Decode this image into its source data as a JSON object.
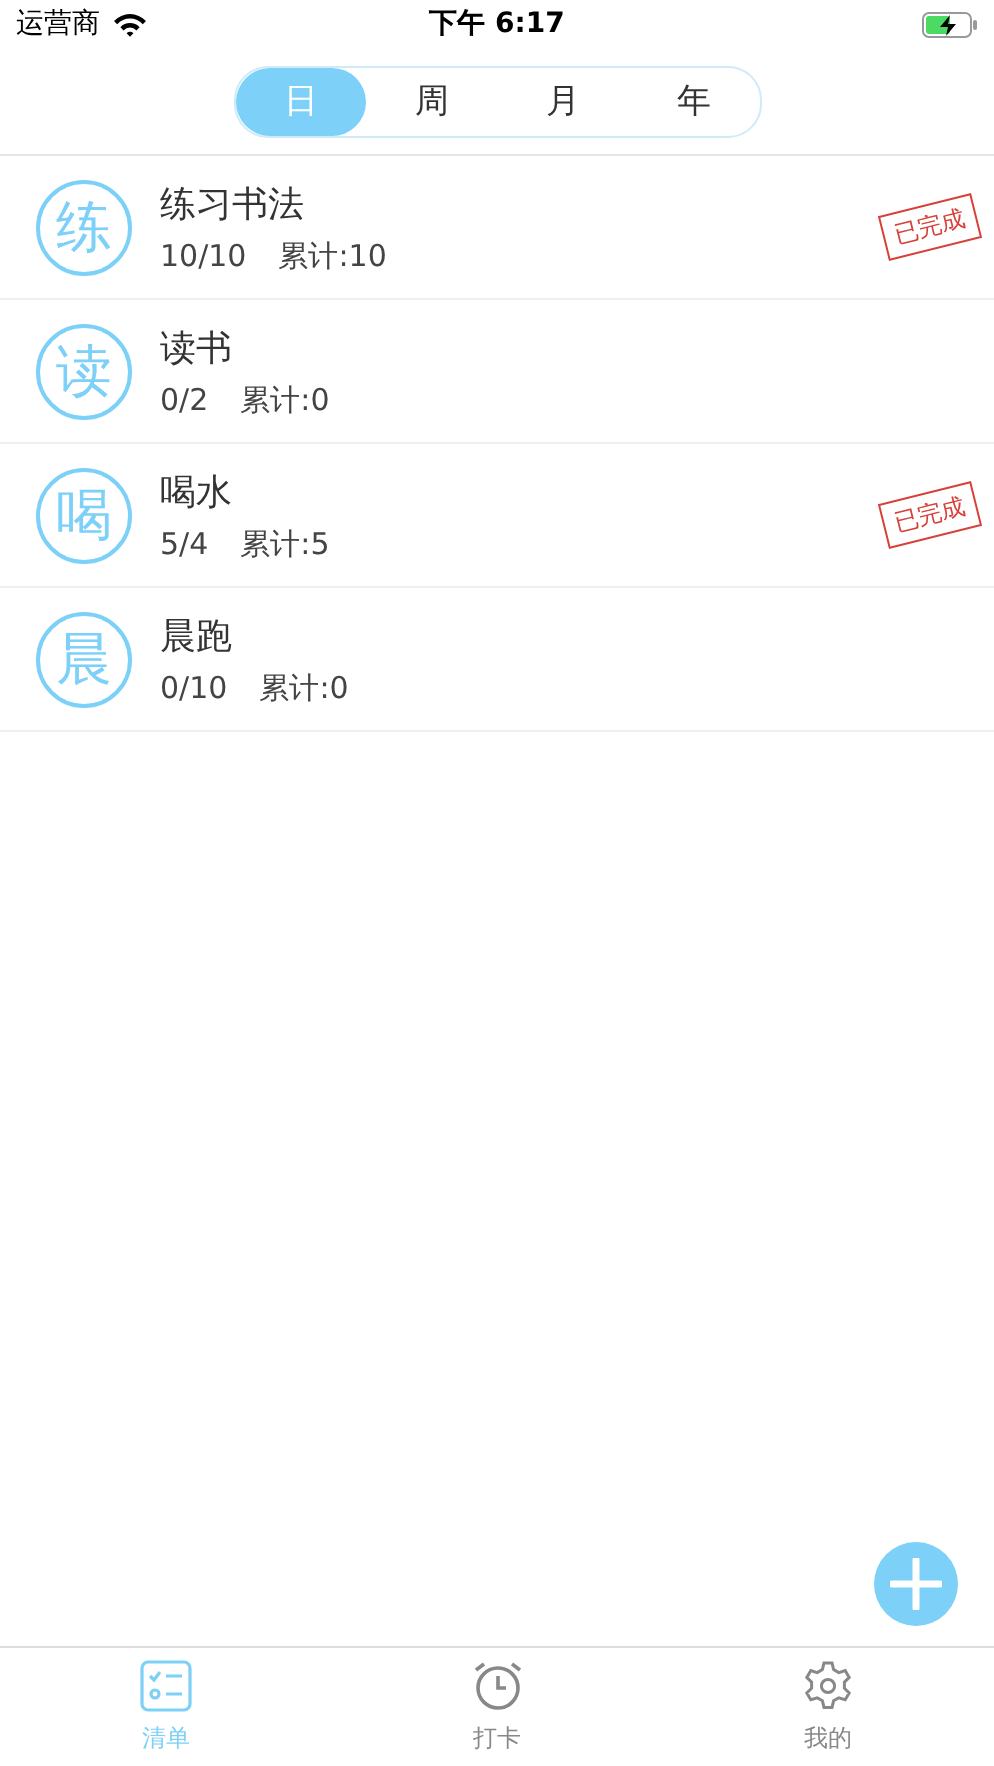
{
  "status_bar": {
    "carrier": "运营商",
    "time": "下午 6:17"
  },
  "period_tabs": [
    {
      "label": "日",
      "selected": true
    },
    {
      "label": "周",
      "selected": false
    },
    {
      "label": "月",
      "selected": false
    },
    {
      "label": "年",
      "selected": false
    }
  ],
  "habits": [
    {
      "badge": "练",
      "name": "练习书法",
      "progress": "10/10",
      "total": "累计:10",
      "done": true,
      "stamp": "已完成"
    },
    {
      "badge": "读",
      "name": "读书",
      "progress": "0/2",
      "total": "累计:0",
      "done": false
    },
    {
      "badge": "喝",
      "name": "喝水",
      "progress": "5/4",
      "total": "累计:5",
      "done": true,
      "stamp": "已完成"
    },
    {
      "badge": "晨",
      "name": "晨跑",
      "progress": "0/10",
      "total": "累计:0",
      "done": false
    }
  ],
  "bottom_tabs": [
    {
      "kind": "list",
      "label": "清单",
      "selected": true
    },
    {
      "kind": "alarm",
      "label": "打卡",
      "selected": false
    },
    {
      "kind": "settings",
      "label": "我的",
      "selected": false
    }
  ]
}
